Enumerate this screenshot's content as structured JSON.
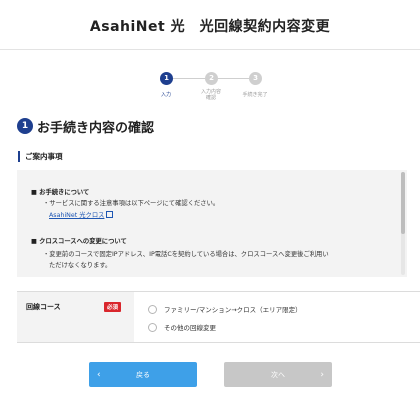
{
  "header": {
    "title": "AsahiNet 光　光回線契約内容変更"
  },
  "stepper": {
    "steps": [
      {
        "number": "1",
        "label": "入力",
        "state": "active"
      },
      {
        "number": "2",
        "label": "入力内容\n確認",
        "state": "inactive"
      },
      {
        "number": "3",
        "label": "手続き完了",
        "state": "inactive"
      }
    ]
  },
  "section": {
    "number": "1",
    "title": "お手続き内容の確認"
  },
  "guide": {
    "heading": "ご案内事項",
    "items": [
      {
        "heading": "■ お手続きについて",
        "text": "・サービスに関する注意事項は以下ページにて確認ください。",
        "link": "AsahiNet 光クロス"
      },
      {
        "heading": "■ クロスコースへの変更について",
        "text_line1": "・変更前のコースで固定IPアドレス、IP電話Cを契約している場合は、クロスコースへ変更後ご利用い",
        "text_line2": "ただけなくなります。"
      }
    ]
  },
  "form": {
    "label": "回線コース",
    "required_badge": "必須",
    "options": [
      "ファミリー/マンション→クロス（エリア限定）",
      "その他の回線変更"
    ]
  },
  "buttons": {
    "back": "戻る",
    "next": "次へ",
    "back_icon": "chevron-left",
    "next_icon": "chevron-right"
  },
  "colors": {
    "brand_navy": "#1e3f8f",
    "back_button": "#3ea0e8",
    "next_button_disabled": "#c7c7c7",
    "required_badge": "#d9262c",
    "link": "#1e56b3"
  }
}
